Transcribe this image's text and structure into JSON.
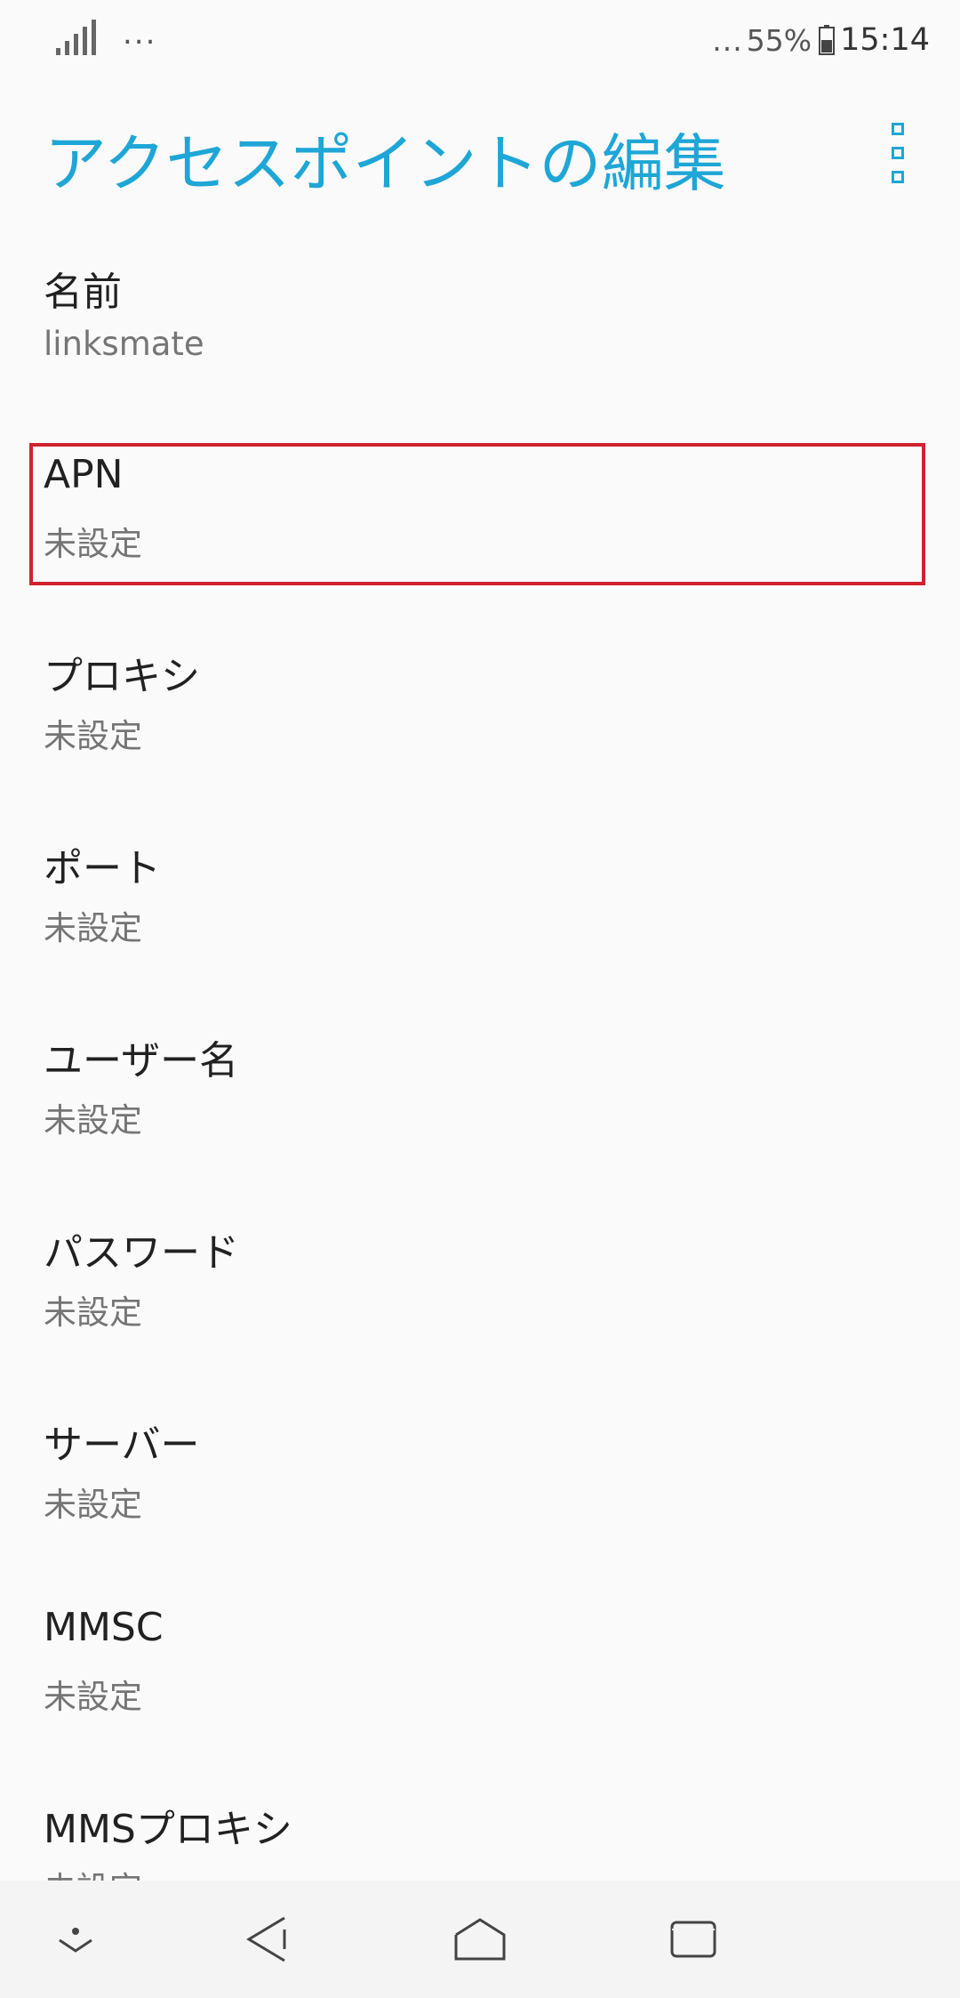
{
  "status_bar": {
    "left_dots": "...",
    "right_dots": "...",
    "battery_percent": "55%",
    "time": "15:14"
  },
  "app_bar": {
    "title": "アクセスポイントの編集",
    "overflow_icon": "more-vert-icon"
  },
  "preferences": [
    {
      "title": "名前",
      "value": "linksmate"
    },
    {
      "title": "APN",
      "value": "未設定"
    },
    {
      "title": "プロキシ",
      "value": "未設定"
    },
    {
      "title": "ポート",
      "value": "未設定"
    },
    {
      "title": "ユーザー名",
      "value": "未設定"
    },
    {
      "title": "パスワード",
      "value": "未設定"
    },
    {
      "title": "サーバー",
      "value": "未設定"
    },
    {
      "title": "MMSC",
      "value": "未設定"
    },
    {
      "title": "MMSプロキシ",
      "value": "未設定"
    }
  ],
  "colors": {
    "accent": "#1ea6d6",
    "highlight": "#d0232e",
    "background": "#fafafa"
  },
  "nav_bar": {
    "icons": [
      "notification-pull-icon",
      "back-icon",
      "home-icon",
      "recents-icon"
    ]
  }
}
